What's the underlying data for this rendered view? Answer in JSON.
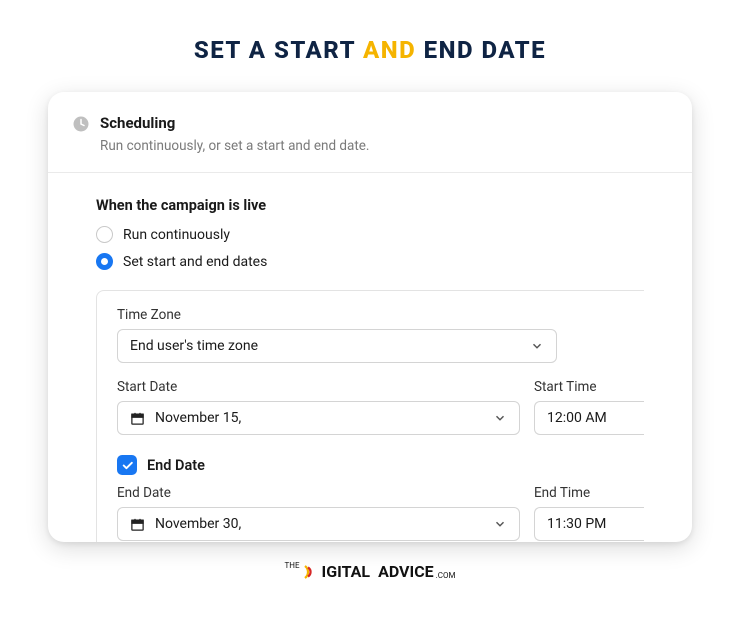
{
  "heading": {
    "part1": "SET A START ",
    "accent": "AND",
    "part2": " END DATE"
  },
  "card": {
    "title": "Scheduling",
    "subtitle": "Run continuously, or set a start and end date."
  },
  "live": {
    "label": "When the campaign is live",
    "option_continuous": "Run continuously",
    "option_dates": "Set start and end dates"
  },
  "timezone": {
    "label": "Time Zone",
    "value": "End user's time zone"
  },
  "start": {
    "date_label": "Start Date",
    "date_value": "November 15,",
    "time_label": "Start Time",
    "time_value": "12:00 AM"
  },
  "end": {
    "checkbox_label": "End Date",
    "date_label": "End Date",
    "date_value": "November 30,",
    "time_label": "End Time",
    "time_value": "11:30 PM"
  },
  "footer": {
    "the": "THE",
    "brand1": "IGITAL",
    "brand2": "ADVICE",
    "com": ".COM"
  }
}
